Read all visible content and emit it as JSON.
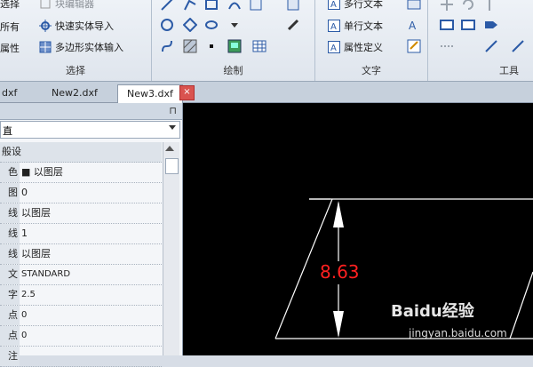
{
  "ribbon": {
    "select_group": {
      "items": [
        "选择",
        "所有",
        "属性"
      ],
      "faded_item": "块编辑器",
      "import_solid": "快速实体导入",
      "polygon_solid": "多边形实体输入",
      "label": "选择"
    },
    "draw_group": {
      "label": "绘制"
    },
    "text_group": {
      "mtext": "多行文本",
      "stext": "单行文本",
      "attdef": "属性定义",
      "label": "文字"
    },
    "tools_group": {
      "label": "工具"
    }
  },
  "tabs": [
    "dxf",
    "New2.dxf",
    "New3.dxf"
  ],
  "tab_close": "×",
  "properties": {
    "pin": "⊓",
    "dropdown_value": "直",
    "rows": [
      {
        "k": "般设",
        "v": ""
      },
      {
        "k": "色",
        "v": "■ 以图层"
      },
      {
        "k": "图",
        "v": "0"
      },
      {
        "k": "线",
        "v": "以图层"
      },
      {
        "k": "线",
        "v": "1"
      },
      {
        "k": "线",
        "v": "以图层"
      },
      {
        "k": "文",
        "v": "STANDARD"
      },
      {
        "k": "字",
        "v": "2.5"
      },
      {
        "k": "点",
        "v": "0"
      },
      {
        "k": "点",
        "v": "0"
      },
      {
        "k": "注",
        "v": ""
      }
    ]
  },
  "drawing": {
    "dimension_value": "8.63",
    "dimension_color": "#ff2020",
    "line_color": "#ffffff"
  },
  "watermark": {
    "brand": "Baidu经验",
    "url": "jingyan.baidu.com"
  }
}
